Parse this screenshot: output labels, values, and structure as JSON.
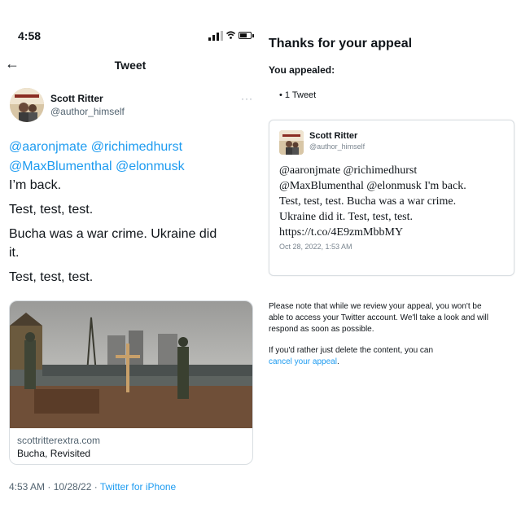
{
  "phone": {
    "status_time": "4:58",
    "header": {
      "back_icon": "back-arrow-icon",
      "title": "Tweet"
    },
    "tweet": {
      "author_name": "Scott Ritter",
      "author_handle": "@author_himself",
      "more_icon_glyph": "···",
      "mentions_line1": "@aaronjmate @richimedhurst",
      "mentions_line2": "@MaxBlumenthal @elonmusk",
      "line_back": "I’m back.",
      "line_test1": "Test, test, test.",
      "line_bucha1": "Bucha was a war crime. Ukraine did",
      "line_bucha2": "it.",
      "line_test2": "Test, test, test.",
      "card": {
        "domain": "scottritterextra.com",
        "title": "Bucha, Revisited"
      },
      "timestamp": "4:53 AM · 10/28/22 · ",
      "client": "Twitter for iPhone"
    }
  },
  "appeal": {
    "title": "Thanks for your appeal",
    "appealed_label": "You appealed:",
    "bullet_item": "•  1 Tweet",
    "embed": {
      "author_name": "Scott Ritter",
      "author_handle": "@author_himself",
      "text_line1": "@aaronjmate @richimedhurst",
      "text_line2": "@MaxBlumenthal @elonmusk I'm back.",
      "text_line3": "Test, test, test. Bucha was a war crime.",
      "text_line4": "Ukraine did it. Test, test, test.",
      "text_line5": "https://t.co/4E9zmMbbMY",
      "date": "Oct 28, 2022, 1:53 AM"
    },
    "note_line1": "Please note that while we review your appeal, you won't be",
    "note_line2": "able to access your Twitter account. We'll take a look and will",
    "note_line3": "respond as soon as possible.",
    "delete_prefix": "If you'd rather just delete the content, you can",
    "cancel_link": "cancel your appeal",
    "cancel_suffix": "."
  },
  "colors": {
    "link": "#1d9bf0",
    "muted": "#536471",
    "border": "#d9dee2"
  }
}
